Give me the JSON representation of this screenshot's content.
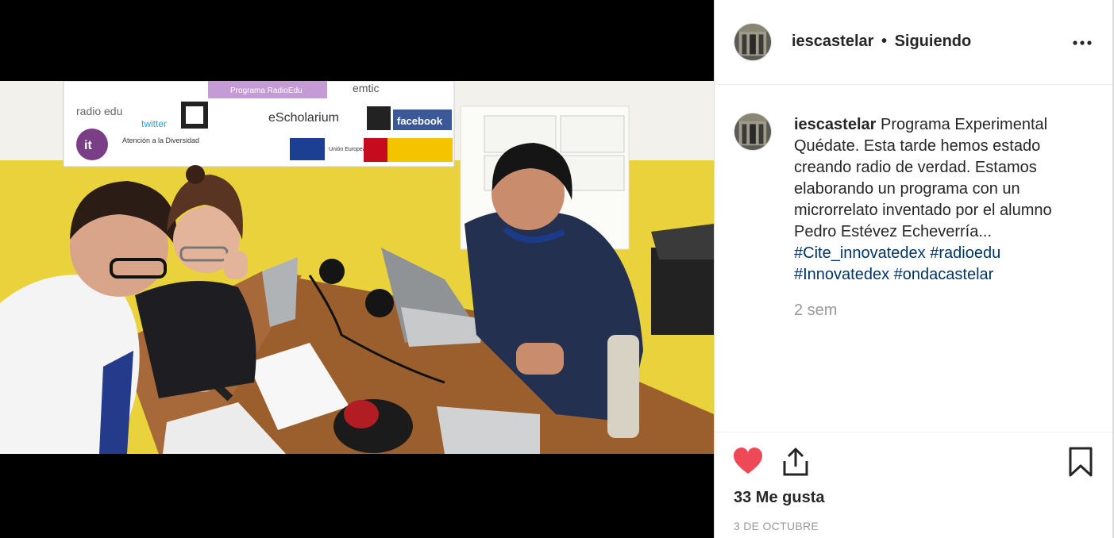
{
  "post": {
    "username": "iescastelar",
    "follow_status": "Siguiendo",
    "separator": "•",
    "more_icon": "more-horizontal-icon"
  },
  "comment": {
    "username": "iescastelar",
    "text": "Programa Experimental Quédate. Esta tarde hemos estado creando radio de verdad. Estamos elaborando un programa con un microrrelato inventado por el alumno Pedro Estévez Echeverría...",
    "hashtags": [
      "#Cite_innovatedex",
      "#radioedu",
      "#Innovatedex",
      "#ondacastelar"
    ],
    "time_ago": "2 sem"
  },
  "actions": {
    "like_icon": "heart-icon",
    "share_icon": "share-icon",
    "save_icon": "bookmark-icon",
    "likes_text": "33 Me gusta",
    "date_text": "3 DE OCTUBRE"
  },
  "photo": {
    "banner_texts": [
      "Programa RadioEdu",
      "emtic",
      "radio edu",
      "twitter",
      "eScholarium",
      "facebook",
      "Atención a la Diversidad",
      "Unión Europea",
      "it"
    ]
  },
  "colors": {
    "like_red": "#ed4956",
    "hashtag_blue": "#003569",
    "meta_gray": "#999999",
    "text_dark": "#262626"
  }
}
